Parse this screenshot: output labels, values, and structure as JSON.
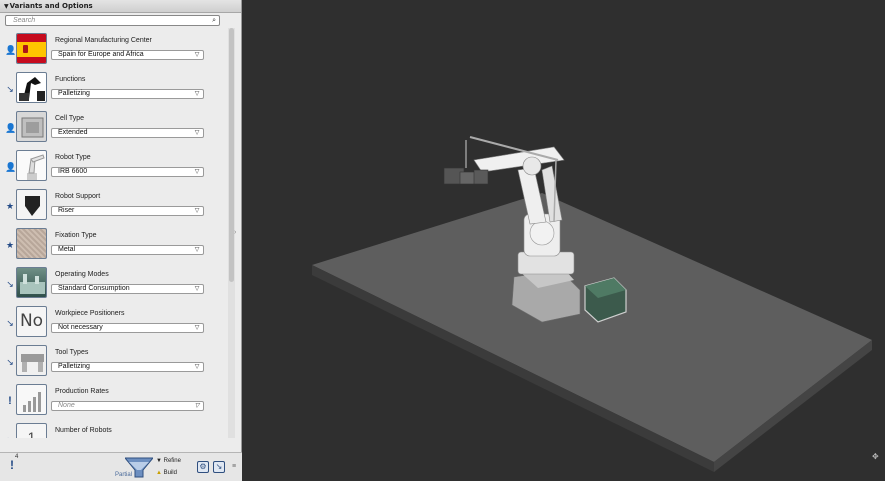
{
  "panel": {
    "title": "Variants and Options",
    "collapse_icon": "triangle-down-icon",
    "search": {
      "placeholder": "Search",
      "value": ""
    }
  },
  "options": [
    {
      "label": "Regional Manufacturing Center",
      "value": "Spain for Europe and Africa",
      "mark": "person-icon",
      "thumb": "spain-flag",
      "muted": false
    },
    {
      "label": "Functions",
      "value": "Palletizing",
      "mark": "arrow-icon",
      "thumb": "palletizing-robot",
      "muted": false
    },
    {
      "label": "Cell Type",
      "value": "Extended",
      "mark": "person-icon",
      "thumb": "cell-box",
      "muted": false
    },
    {
      "label": "Robot Type",
      "value": "IRB 6600",
      "mark": "person-icon",
      "thumb": "robot-arm",
      "muted": false
    },
    {
      "label": "Robot Support",
      "value": "Riser",
      "mark": "star-icon",
      "thumb": "riser-arrow",
      "muted": false
    },
    {
      "label": "Fixation Type",
      "value": "Metal",
      "mark": "star-icon",
      "thumb": "metal-texture",
      "muted": false
    },
    {
      "label": "Operating Modes",
      "value": "Standard Consumption",
      "mark": "arrow-icon",
      "thumb": "factory",
      "muted": false
    },
    {
      "label": "Workpiece Positioners",
      "value": "Not necessary",
      "mark": "arrow-icon",
      "thumb": "no-sign",
      "muted": false
    },
    {
      "label": "Tool Types",
      "value": "Palletizing",
      "mark": "arrow-icon",
      "thumb": "gripper",
      "muted": false
    },
    {
      "label": "Production Rates",
      "value": "None",
      "mark": "exclamation-icon",
      "thumb": "bar-chart",
      "muted": true
    },
    {
      "label": "Number of Robots",
      "value": "",
      "mark": "arrow-icon",
      "thumb": "number-one",
      "muted": false
    }
  ],
  "footer": {
    "warning_count": "4",
    "mode": "Partial",
    "refine_label": "Refine",
    "build_label": "Build"
  },
  "colors": {
    "accent": "#234a86",
    "panel_bg": "#ececec",
    "viewport_bg": "#2f2f2f",
    "floor": "#5f5f5f"
  }
}
